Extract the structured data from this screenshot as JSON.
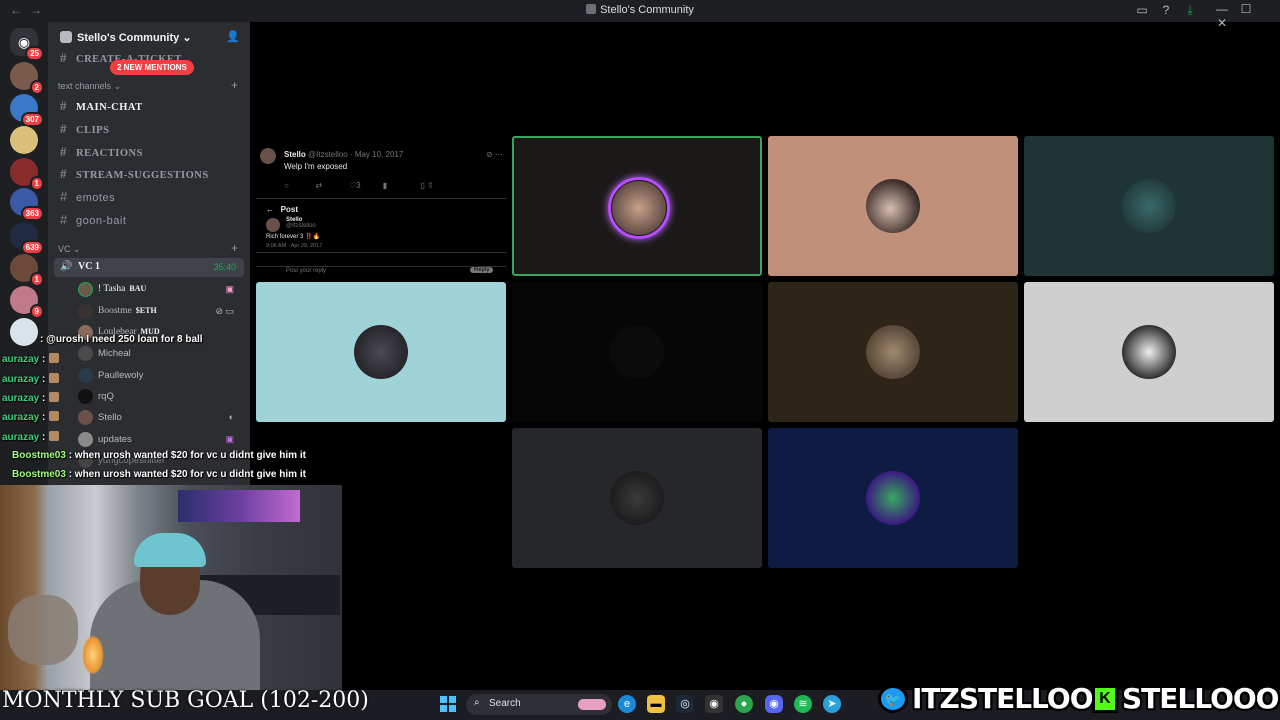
{
  "window": {
    "title": "Stello's Community",
    "nav_back": "←",
    "nav_fwd": "→"
  },
  "titlebar_tools": {
    "inbox_icon": "inbox-icon",
    "help_icon": "help-icon",
    "download_icon": "download-icon"
  },
  "window_controls": {
    "minimize": "—",
    "maximize": "☐",
    "close": "✕"
  },
  "rail": {
    "home_badge": "25",
    "servers": [
      {
        "badge": "2"
      },
      {
        "badge": "307"
      },
      {
        "badge": ""
      },
      {
        "badge": "1"
      },
      {
        "badge": "363"
      },
      {
        "badge": "639"
      },
      {
        "badge": "1"
      },
      {
        "badge": "9"
      },
      {
        "badge": ""
      }
    ]
  },
  "sidebar": {
    "server_name": "Stello's Community",
    "chevron": "⌄",
    "mentions_pill": "2 NEW MENTIONS",
    "top_channel": "CREATE-A-TICKET",
    "text_category": "text channels",
    "channels": [
      {
        "name": "MAIN-CHAT"
      },
      {
        "name": "CLIPS"
      },
      {
        "name": "REACTIONS"
      },
      {
        "name": "STREAM-SUGGESTIONS"
      },
      {
        "name": "emotes"
      },
      {
        "name": "goon-bait"
      }
    ],
    "vc_category": "VC",
    "voice_channel": {
      "name": "VC 1",
      "time": "35:40"
    },
    "members": [
      {
        "name": "! Tasha",
        "tag": "BAU"
      },
      {
        "name": "Boostme",
        "tag": "$ETH"
      },
      {
        "name": "Loulebear",
        "tag": "MUD"
      },
      {
        "name": "Micheal",
        "tag": ""
      },
      {
        "name": "Paullewoly",
        "tag": ""
      },
      {
        "name": "rqQ",
        "tag": ""
      },
      {
        "name": "Stello",
        "tag": ""
      },
      {
        "name": "updates",
        "tag": ""
      },
      {
        "name": "yungcopeshifter",
        "tag": ""
      }
    ]
  },
  "stream": {
    "author": "Stello",
    "handle": "@Itzstelloo · May 10, 2017",
    "text": "Welp I'm exposed",
    "likes": "3",
    "post_header": "Post",
    "inner_author": "Stello",
    "inner_handle": "@Itzstelloo",
    "inner_text": "Rich forever 3 ‼️🔥",
    "inner_date": "9:06 AM · Apr 29, 2017",
    "reply_placeholder": "Post your reply",
    "reply_button": "Reply"
  },
  "chat": [
    {
      "user": "",
      "msg": ": @urosh I need 250 loan for 8 ball"
    },
    {
      "user": "aurazay",
      "msg": ":"
    },
    {
      "user": "aurazay",
      "msg": ":"
    },
    {
      "user": "aurazay",
      "msg": ":"
    },
    {
      "user": "aurazay",
      "msg": ":"
    },
    {
      "user": "aurazay",
      "msg": ":"
    },
    {
      "user": "Boostme03",
      "msg": ": when urosh wanted $20 for vc u didnt give him it"
    },
    {
      "user": "Boostme03",
      "msg": ": when urosh wanted $20 for vc u didnt give him it"
    }
  ],
  "overlay": {
    "sub_goal": "MONTHLY SUB GOAL (102-200)",
    "twitter_handle": "ITZSTELLOO",
    "kick_handle": "STELLOOO",
    "kick_letter": "K"
  },
  "taskbar": {
    "search_label": "Search"
  },
  "colors": {
    "speaking": "#3ba55d",
    "accent": "#b84cff",
    "badge": "#f23f43",
    "kick": "#53fc18",
    "twitter": "#1d9bf0"
  }
}
